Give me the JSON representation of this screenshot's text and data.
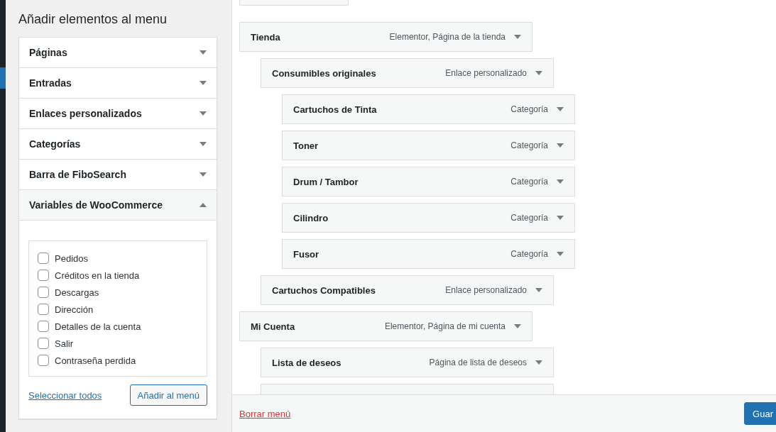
{
  "sidebar": {
    "title": "Añadir elementos al menu",
    "sections": [
      {
        "label": "Páginas",
        "expanded": false
      },
      {
        "label": "Entradas",
        "expanded": false
      },
      {
        "label": "Enlaces personalizados",
        "expanded": false
      },
      {
        "label": "Categorías",
        "expanded": false
      },
      {
        "label": "Barra de FiboSearch",
        "expanded": false
      },
      {
        "label": "Variables de WooCommerce",
        "expanded": true,
        "options": [
          {
            "label": "Pedidos",
            "checked": false
          },
          {
            "label": "Créditos en la tienda",
            "checked": false
          },
          {
            "label": "Descargas",
            "checked": false
          },
          {
            "label": "Dirección",
            "checked": false
          },
          {
            "label": "Detalles de la cuenta",
            "checked": false
          },
          {
            "label": "Salir",
            "checked": false
          },
          {
            "label": "Contraseña perdida",
            "checked": false
          }
        ],
        "select_all": "Seleccionar todos",
        "add_button": "Añadir al menú"
      }
    ]
  },
  "menu_structure": {
    "items": [
      {
        "title": "Tienda",
        "type": "Elementor, Página de la tienda",
        "children": [
          {
            "title": "Consumibles originales",
            "type": "Enlace personalizado",
            "children": [
              {
                "title": "Cartuchos de Tinta",
                "type": "Categoría"
              },
              {
                "title": "Toner",
                "type": "Categoría"
              },
              {
                "title": "Drum / Tambor",
                "type": "Categoría"
              },
              {
                "title": "Cilindro",
                "type": "Categoría"
              },
              {
                "title": "Fusor",
                "type": "Categoría"
              }
            ]
          },
          {
            "title": "Cartuchos Compatibles",
            "type": "Enlace personalizado"
          }
        ]
      },
      {
        "title": "Mi Cuenta",
        "type": "Elementor, Página de mi cuenta",
        "children": [
          {
            "title": "Lista de deseos",
            "type": "Página de lista de deseos"
          }
        ]
      }
    ]
  },
  "footer": {
    "delete_link": "Borrar menú",
    "save_button": "Guar"
  }
}
